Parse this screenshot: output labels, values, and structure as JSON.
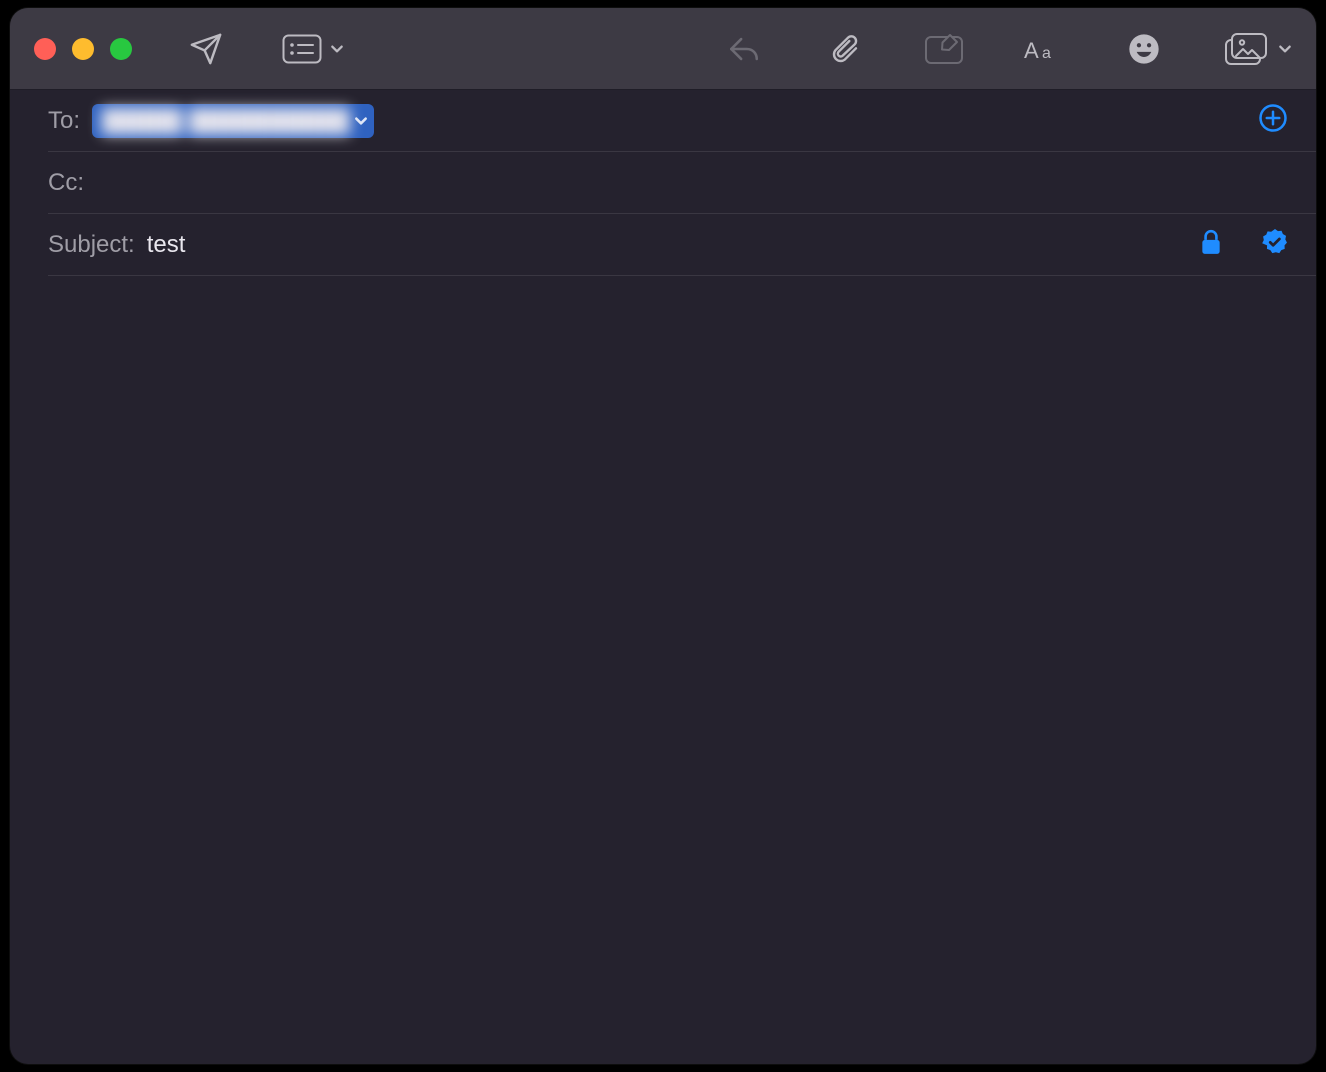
{
  "window": {
    "traffic_lights": {
      "close": "close",
      "minimize": "minimize",
      "zoom": "zoom"
    }
  },
  "toolbar": {
    "send": "send",
    "header_options": "header-fields",
    "reply": "reply",
    "attach": "attach",
    "markup": "markup",
    "format": "format",
    "emoji": "emoji",
    "photos": "photo-browser"
  },
  "fields": {
    "to_label": "To:",
    "to_recipient_name": "█████ ██████████",
    "cc_label": "Cc:",
    "subject_label": "Subject:",
    "subject_value": "test",
    "add_contact": "add-recipient",
    "encrypt": "encrypt",
    "sign": "sign"
  },
  "body": {
    "content": ""
  },
  "colors": {
    "accent_blue": "#1f8cff",
    "chip_blue": "#2f62c0",
    "window_bg": "#25222e",
    "titlebar_bg": "#3d3a44"
  }
}
